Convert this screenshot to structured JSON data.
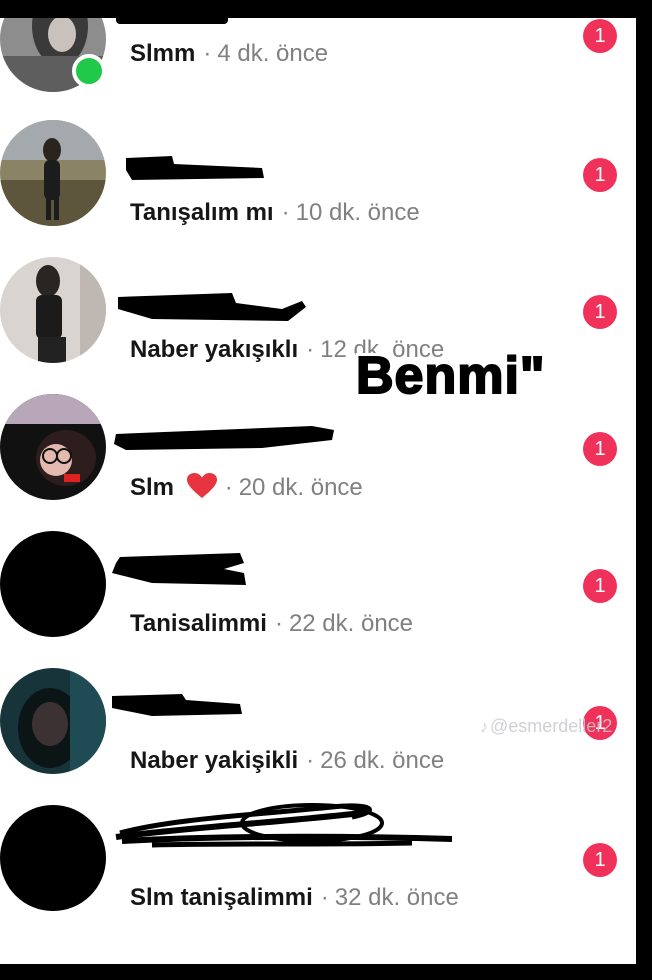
{
  "messages": [
    {
      "preview": "Slmm",
      "time": "4 dk. önce",
      "unread": "1",
      "online": true
    },
    {
      "preview": "Tanışalım mı",
      "time": "10 dk. önce",
      "unread": "1"
    },
    {
      "preview": "Naber yakışıklı",
      "time": "12 dk. önce",
      "unread": "1"
    },
    {
      "preview": "Slm",
      "time": "20 dk. önce",
      "unread": "1",
      "emoji": "heart-icon"
    },
    {
      "preview": "Tanisalimmi",
      "time": "22 dk. önce",
      "unread": "1"
    },
    {
      "preview": "Naber yakişikli",
      "time": "26 dk. önce",
      "unread": "1"
    },
    {
      "preview": "Slm tanişalimmi",
      "time": "32 dk. önce",
      "unread": "1"
    }
  ],
  "separator": "·",
  "overlay": {
    "text": "Benmi\""
  },
  "watermark": {
    "text": "@esmerdeller2",
    "icon": "tiktok-icon"
  },
  "colors": {
    "badge": "#f0325a",
    "online": "#20c94a",
    "time": "#808080",
    "heart": "#e8343f"
  }
}
